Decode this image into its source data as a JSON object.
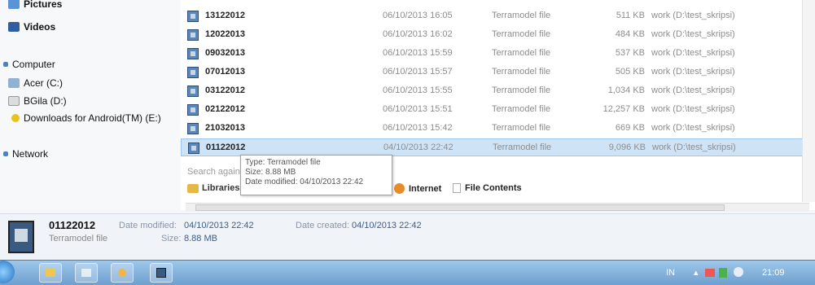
{
  "nav": {
    "items": [
      {
        "label": "Pictures"
      },
      {
        "label": "Videos"
      },
      {
        "label": "Computer"
      },
      {
        "label": "Acer (C:)"
      },
      {
        "label": "BGila (D:)"
      },
      {
        "label": "Downloads for Android(TM) (E:)"
      },
      {
        "label": "Network"
      }
    ]
  },
  "files": [
    {
      "name": "13122012",
      "date": "06/10/2013 16:05",
      "type": "Terramodel file",
      "size": "511 KB",
      "folder": "work (D:\\test_skripsi)"
    },
    {
      "name": "12022013",
      "date": "06/10/2013 16:02",
      "type": "Terramodel file",
      "size": "484 KB",
      "folder": "work (D:\\test_skripsi)"
    },
    {
      "name": "09032013",
      "date": "06/10/2013 15:59",
      "type": "Terramodel file",
      "size": "537 KB",
      "folder": "work (D:\\test_skripsi)"
    },
    {
      "name": "07012013",
      "date": "06/10/2013 15:57",
      "type": "Terramodel file",
      "size": "505 KB",
      "folder": "work (D:\\test_skripsi)"
    },
    {
      "name": "03122012",
      "date": "06/10/2013 15:55",
      "type": "Terramodel file",
      "size": "1,034 KB",
      "folder": "work (D:\\test_skripsi)"
    },
    {
      "name": "02122012",
      "date": "06/10/2013 15:51",
      "type": "Terramodel file",
      "size": "12,257 KB",
      "folder": "work (D:\\test_skripsi)"
    },
    {
      "name": "21032013",
      "date": "06/10/2013 15:42",
      "type": "Terramodel file",
      "size": "669 KB",
      "folder": "work (D:\\test_skripsi)"
    },
    {
      "name": "01122012",
      "date": "04/10/2013 22:42",
      "type": "Terramodel file",
      "size": "9,096 KB",
      "folder": "work (D:\\test_skripsi)"
    }
  ],
  "tooltip": {
    "type": "Type: Terramodel file",
    "size": "Size: 8.88 MB",
    "date": "Date modified: 04/10/2013 22:42"
  },
  "search_again": {
    "label": "Search again in:",
    "libraries": "Libraries",
    "internet": "Internet",
    "file_contents": "File Contents"
  },
  "details": {
    "name": "01122012",
    "type": "Terramodel file",
    "modified_label": "Date modified:",
    "modified_value": "04/10/2013 22:42",
    "created_label": "Date created:",
    "created_value": "04/10/2013 22:42",
    "size_label": "Size:",
    "size_value": "8.88 MB"
  },
  "taskbar": {
    "lang": "IN",
    "time": "21:09"
  }
}
